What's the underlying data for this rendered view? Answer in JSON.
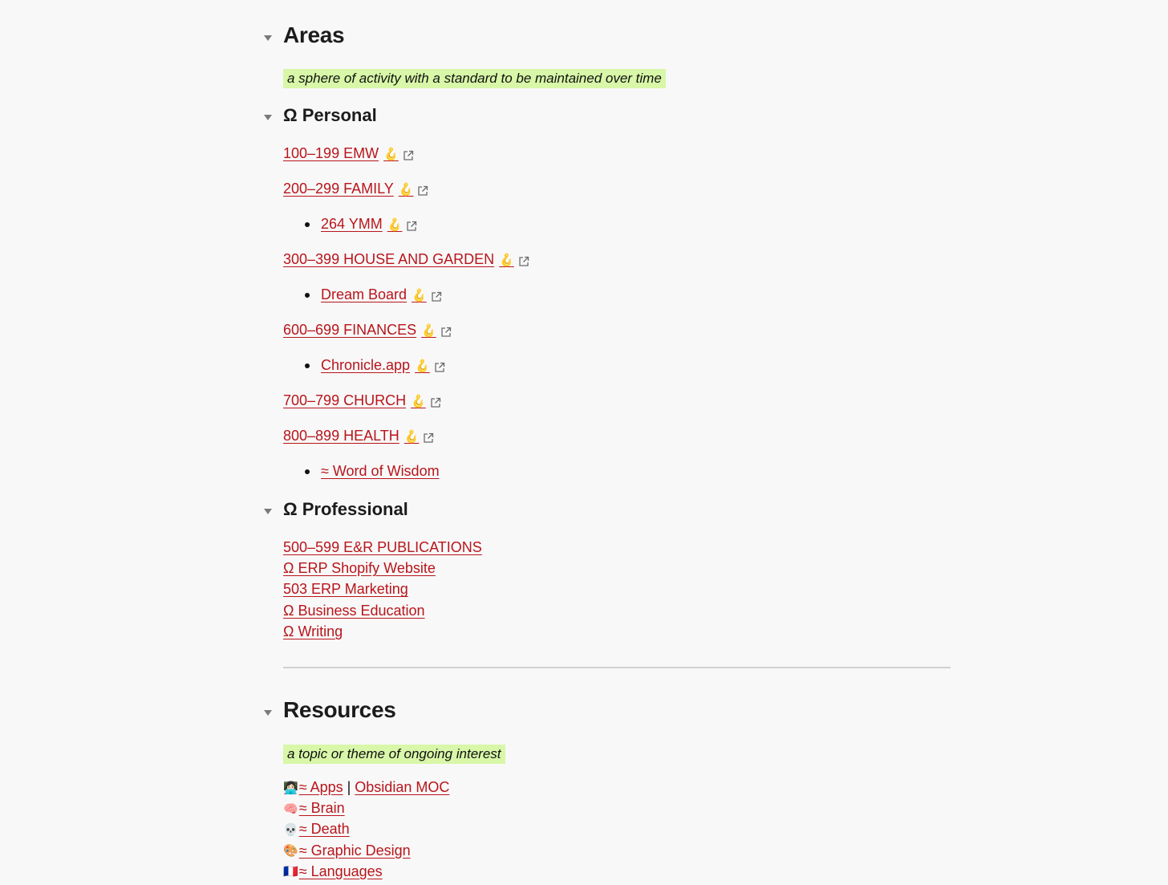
{
  "areas": {
    "title": "Areas",
    "definition": "a sphere of activity with a standard to be maintained over time",
    "personal": {
      "title": "Ω Personal",
      "items": [
        {
          "label": "100–199 EMW",
          "hook": "🪝",
          "external": true,
          "level": 0
        },
        {
          "label": "200–299 FAMILY",
          "hook": "🪝",
          "external": true,
          "level": 0
        },
        {
          "label": "264 YMM",
          "hook": "🪝",
          "external": true,
          "level": 1
        },
        {
          "label": "300–399 HOUSE AND GARDEN",
          "hook": "🪝",
          "external": true,
          "level": 0
        },
        {
          "label": "Dream Board",
          "hook": "🪝",
          "external": true,
          "level": 1
        },
        {
          "label": "600–699 FINANCES",
          "hook": "🪝",
          "external": true,
          "level": 0
        },
        {
          "label": "Chronicle.app",
          "hook": "🪝",
          "external": true,
          "level": 1
        },
        {
          "label": "700–799 CHURCH",
          "hook": "🪝",
          "external": true,
          "level": 0
        },
        {
          "label": "800–899 HEALTH",
          "hook": "🪝",
          "external": true,
          "level": 0
        },
        {
          "label": "≈ Word of Wisdom",
          "level": 1
        }
      ]
    },
    "professional": {
      "title": "Ω Professional",
      "items": [
        "500–599 E&R PUBLICATIONS",
        "Ω ERP Shopify Website",
        "503 ERP Marketing",
        "Ω Business Education",
        "Ω Writing"
      ]
    }
  },
  "resources": {
    "title": "Resources",
    "definition": "a topic or theme of ongoing interest",
    "items": [
      {
        "emoji": "👩🏻‍💻",
        "label": "≈ Apps",
        "separator": "|",
        "extra": "Obsidian MOC"
      },
      {
        "emoji": "🧠",
        "label": "≈ Brain"
      },
      {
        "emoji": "💀",
        "label": "≈ Death"
      },
      {
        "emoji": "🎨",
        "label": "≈ Graphic Design"
      },
      {
        "emoji": "🇫🇷",
        "label": "≈ Languages"
      }
    ]
  },
  "colors": {
    "link": "#b8151b",
    "highlight": "#d8f7a8",
    "background": "#f8f8f8"
  }
}
